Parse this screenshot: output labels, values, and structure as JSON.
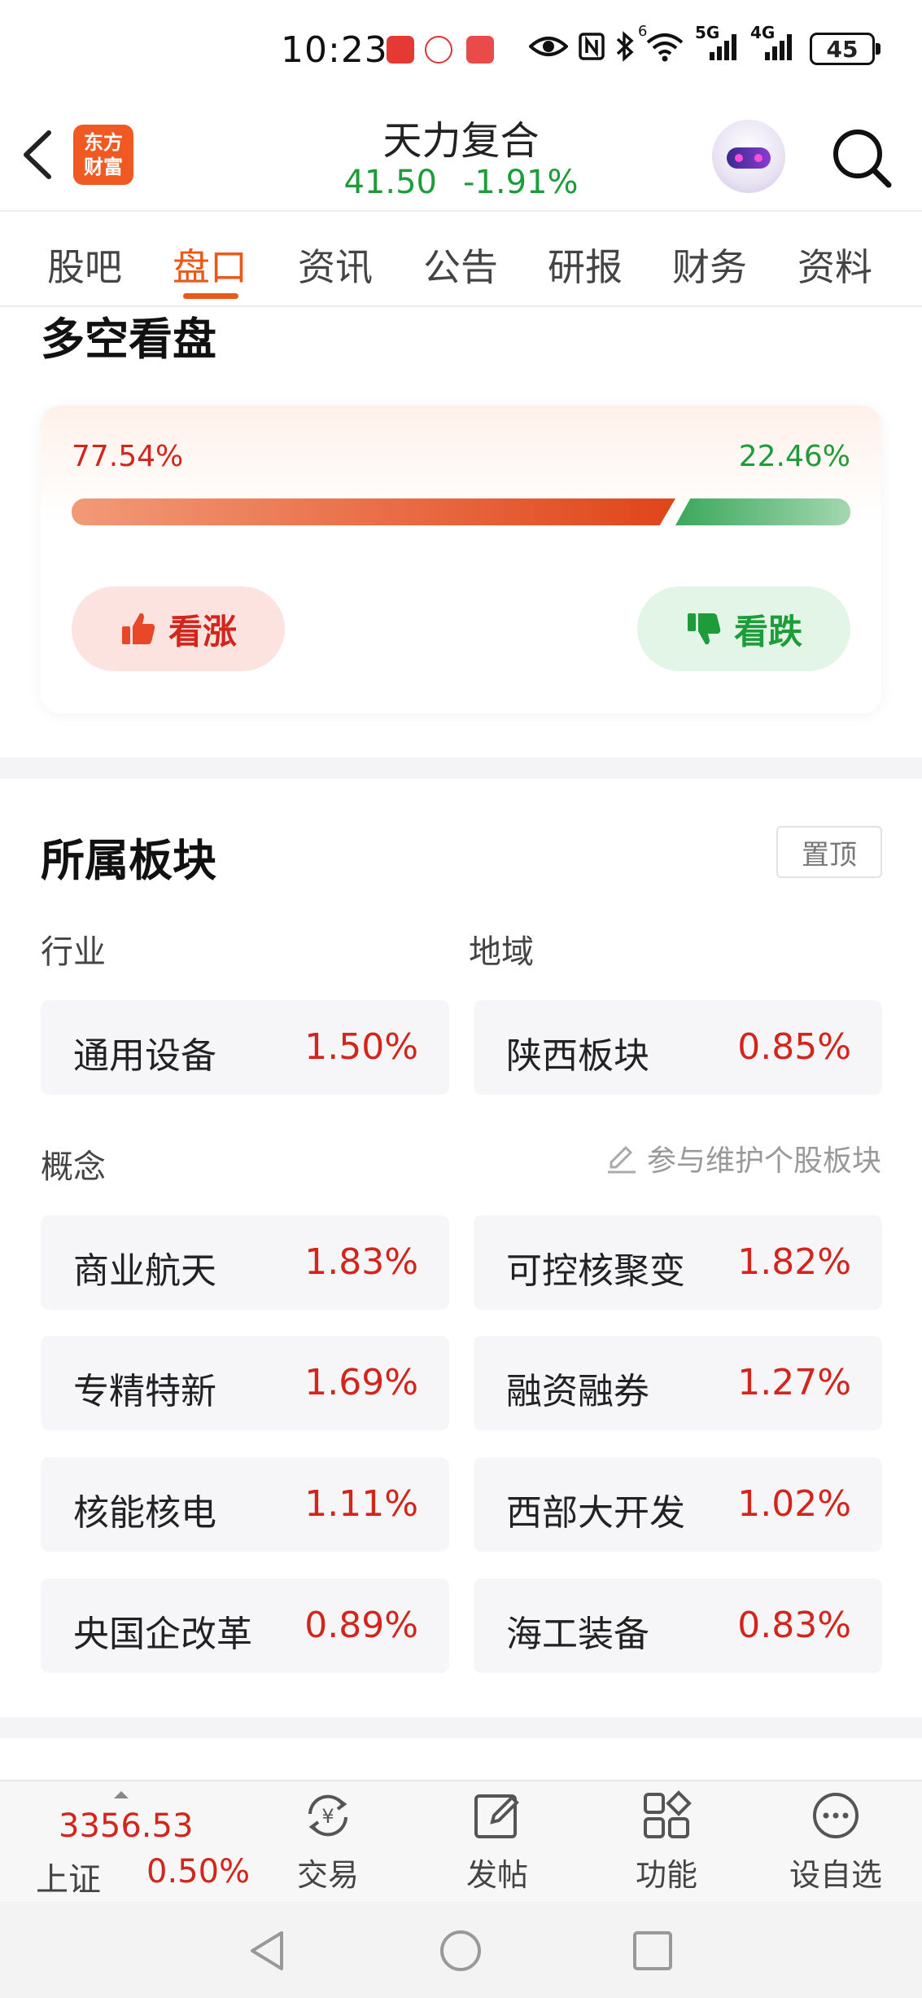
{
  "status_bar": {
    "time": "10:23",
    "network": "5G",
    "network2": "4G",
    "wifi_badge": "6",
    "battery": "45"
  },
  "header": {
    "logo": "东方财富",
    "stock_name": "天力复合",
    "price": "41.50",
    "change_pct": "-1.91%"
  },
  "tabs": [
    {
      "label": "股吧"
    },
    {
      "label": "盘口"
    },
    {
      "label": "资讯"
    },
    {
      "label": "公告"
    },
    {
      "label": "研报"
    },
    {
      "label": "财务"
    },
    {
      "label": "资料"
    }
  ],
  "sentiment": {
    "title": "多空看盘",
    "bull_pct_text": "77.54%",
    "bear_pct_text": "22.46%",
    "bull_fraction": 0.7754,
    "bull_button": "看涨",
    "bear_button": "看跌"
  },
  "sectors": {
    "title": "所属板块",
    "pin_button": "置顶",
    "industry_label": "行业",
    "region_label": "地域",
    "concept_label": "概念",
    "maintain_link": "参与维护个股板块",
    "industry": {
      "name": "通用设备",
      "change": "1.50%"
    },
    "region": {
      "name": "陕西板块",
      "change": "0.85%"
    },
    "concepts": [
      {
        "name": "商业航天",
        "change": "1.83%"
      },
      {
        "name": "可控核聚变",
        "change": "1.82%"
      },
      {
        "name": "专精特新",
        "change": "1.69%"
      },
      {
        "name": "融资融券",
        "change": "1.27%"
      },
      {
        "name": "核能核电",
        "change": "1.11%"
      },
      {
        "name": "西部大开发",
        "change": "1.02%"
      },
      {
        "name": "央国企改革",
        "change": "0.89%"
      },
      {
        "name": "海工装备",
        "change": "0.83%"
      }
    ]
  },
  "bottom_bar": {
    "index_value": "3356.53",
    "index_name": "上证",
    "index_change": "0.50%",
    "trade": "交易",
    "post": "发帖",
    "functions": "功能",
    "add_watchlist": "设自选"
  },
  "colors": {
    "accent": "#e8591a",
    "up": "#d2261d",
    "down": "#1e9c3a"
  }
}
